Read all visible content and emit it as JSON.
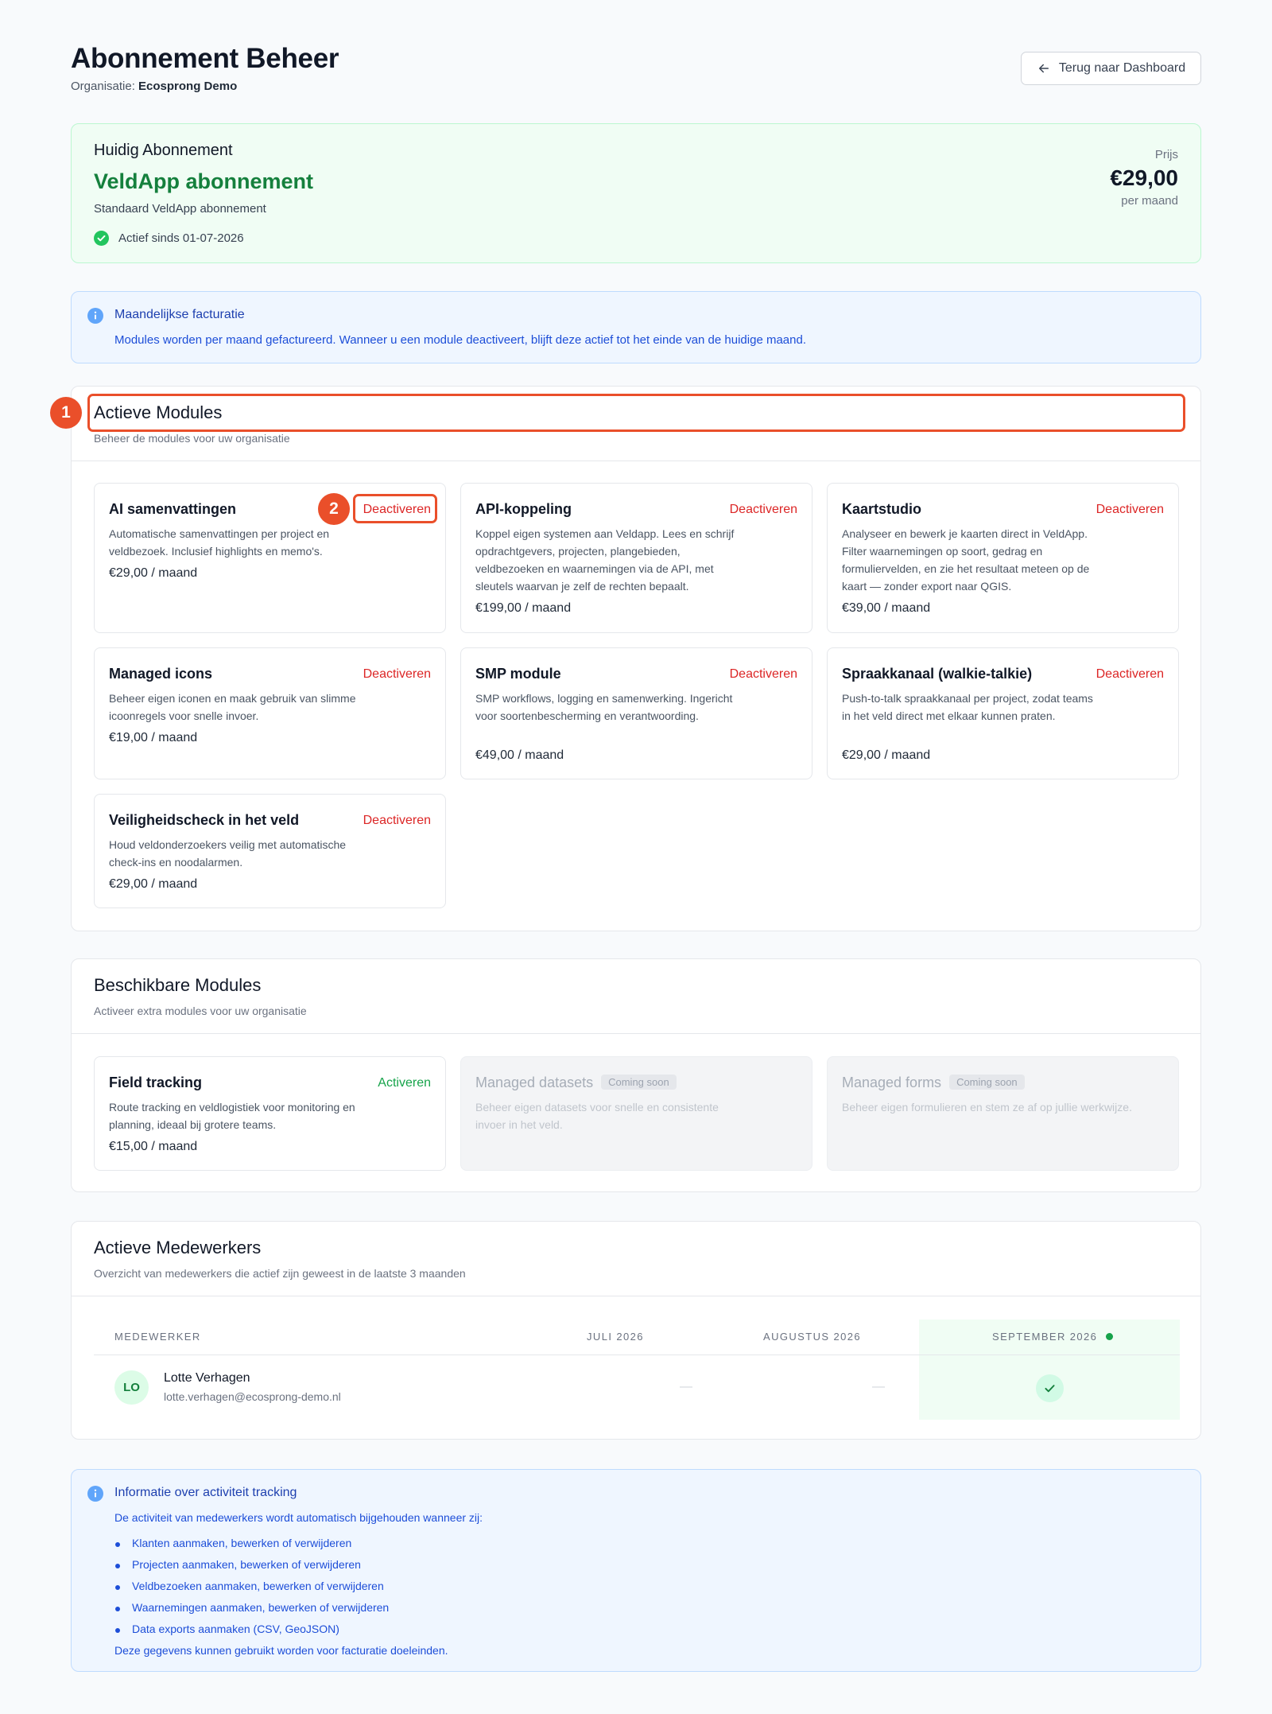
{
  "header": {
    "title": "Abonnement Beheer",
    "org_prefix": "Organisatie:",
    "org_name": "Ecosprong Demo",
    "back_label": "Terug naar Dashboard"
  },
  "current": {
    "label": "Huidig Abonnement",
    "plan": "VeldApp abonnement",
    "description": "Standaard VeldApp abonnement",
    "since": "Actief sinds 01-07-2026",
    "price_label": "Prijs",
    "price": "€29,00",
    "period": "per maand"
  },
  "billing_info": {
    "title": "Maandelijkse facturatie",
    "text": "Modules worden per maand gefactureerd. Wanneer u een module deactiveert, blijft deze actief tot het einde van de huidige maand."
  },
  "active_modules": {
    "title": "Actieve Modules",
    "subtitle": "Beheer de modules voor uw organisatie",
    "items": [
      {
        "name": "AI samenvattingen",
        "action": "Deactiveren",
        "description": "Automatische samenvattingen per project en veldbezoek. Inclusief highlights en memo's.",
        "price": "€29,00 / maand"
      },
      {
        "name": "API-koppeling",
        "action": "Deactiveren",
        "description": "Koppel eigen systemen aan Veldapp. Lees en schrijf opdrachtgevers, projecten, plangebieden, veldbezoeken en waarnemingen via de API, met sleutels waarvan je zelf de rechten bepaalt.",
        "price": "€199,00 / maand"
      },
      {
        "name": "Kaartstudio",
        "action": "Deactiveren",
        "description": "Analyseer en bewerk je kaarten direct in VeldApp. Filter waarnemingen op soort, gedrag en formuliervelden, en zie het resultaat meteen op de kaart — zonder export naar QGIS.",
        "price": "€39,00 / maand"
      },
      {
        "name": "Managed icons",
        "action": "Deactiveren",
        "description": "Beheer eigen iconen en maak gebruik van slimme icoonregels voor snelle invoer.",
        "price": "€19,00 / maand"
      },
      {
        "name": "SMP module",
        "action": "Deactiveren",
        "description": "SMP workflows, logging en samenwerking. Ingericht voor soortenbescherming en verantwoording.",
        "price": "€49,00 / maand"
      },
      {
        "name": "Spraakkanaal (walkie-talkie)",
        "action": "Deactiveren",
        "description": "Push-to-talk spraakkanaal per project, zodat teams in het veld direct met elkaar kunnen praten.",
        "price": "€29,00 / maand"
      },
      {
        "name": "Veiligheidscheck in het veld",
        "action": "Deactiveren",
        "description": "Houd veldonderzoekers veilig met automatische check-ins en noodalarmen.",
        "price": "€29,00 / maand"
      }
    ]
  },
  "available_modules": {
    "title": "Beschikbare Modules",
    "subtitle": "Activeer extra modules voor uw organisatie",
    "items": [
      {
        "name": "Field tracking",
        "action": "Activeren",
        "description": "Route tracking en veldlogistiek voor monitoring en planning, ideaal bij grotere teams.",
        "price": "€15,00 / maand"
      },
      {
        "name": "Managed datasets",
        "badge": "Coming soon",
        "description": "Beheer eigen datasets voor snelle en consistente invoer in het veld."
      },
      {
        "name": "Managed forms",
        "badge": "Coming soon",
        "description": "Beheer eigen formulieren en stem ze af op jullie werkwijze."
      }
    ]
  },
  "employees": {
    "title": "Actieve Medewerkers",
    "subtitle": "Overzicht van medewerkers die actief zijn geweest in de laatste 3 maanden",
    "columns": [
      "MEDEWERKER",
      "JULI 2026",
      "AUGUSTUS 2026",
      "SEPTEMBER 2026"
    ],
    "rows": [
      {
        "initials": "LO",
        "name": "Lotte Verhagen",
        "email": "lotte.verhagen@ecosprong-demo.nl",
        "july": "—",
        "august": "—",
        "september_active": true
      }
    ]
  },
  "tracking_info": {
    "title": "Informatie over activiteit tracking",
    "intro": "De activiteit van medewerkers wordt automatisch bijgehouden wanneer zij:",
    "items": [
      "Klanten aanmaken, bewerken of verwijderen",
      "Projecten aanmaken, bewerken of verwijderen",
      "Veldbezoeken aanmaken, bewerken of verwijderen",
      "Waarnemingen aanmaken, bewerken of verwijderen",
      "Data exports aanmaken (CSV, GeoJSON)"
    ],
    "footer": "Deze gegevens kunnen gebruikt worden voor facturatie doeleinden."
  },
  "annotations": [
    "1",
    "2"
  ],
  "colors": {
    "accent_green": "#15803d",
    "danger_red": "#dc2626",
    "activate_green": "#16a34a",
    "info_blue": "#1d4ed8",
    "marker_orange": "#ea4f2a"
  }
}
